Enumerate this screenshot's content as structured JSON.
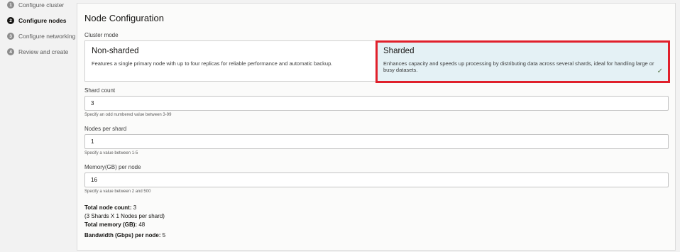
{
  "steps": [
    {
      "num": "1",
      "label": "Configure cluster"
    },
    {
      "num": "2",
      "label": "Configure nodes"
    },
    {
      "num": "3",
      "label": "Configure networking"
    },
    {
      "num": "4",
      "label": "Review and create"
    }
  ],
  "active_step": 2,
  "panel": {
    "title": "Node Configuration"
  },
  "cluster_mode": {
    "label": "Cluster mode",
    "options": [
      {
        "title": "Non-sharded",
        "description": "Features a single primary node with up to four replicas for reliable performance and automatic backup."
      },
      {
        "title": "Sharded",
        "description": "Enhances capacity and speeds up processing by distributing data across several shards, ideal for handling large or busy datasets."
      }
    ],
    "selected": "Sharded",
    "check_glyph": "✓"
  },
  "shard_count": {
    "label": "Shard count",
    "value": "3",
    "hint": "Specify an odd numbered value between 3-99"
  },
  "nodes_per_shard": {
    "label": "Nodes per shard",
    "value": "1",
    "hint": "Specify a value between 1-5"
  },
  "memory_per_node": {
    "label": "Memory(GB) per node",
    "value": "16",
    "hint": "Specify a value between 2 and 500"
  },
  "summary": {
    "total_nodes_label": "Total node count:",
    "total_nodes_value": "3",
    "total_nodes_detail": "(3 Shards X 1 Nodes per shard)",
    "total_memory_label": "Total memory (GB):",
    "total_memory_value": "48",
    "bandwidth_label": "Bandwidth (Gbps) per node:",
    "bandwidth_value": "5"
  },
  "colors": {
    "highlight": "#e0202b",
    "selected_bg": "#e4f1f5"
  }
}
